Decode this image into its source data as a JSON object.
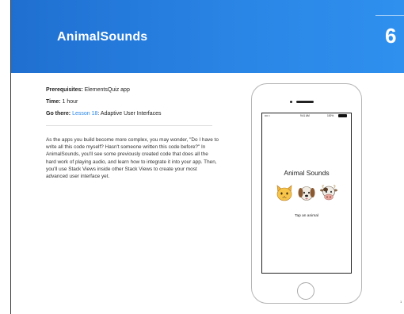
{
  "header": {
    "title": "AnimalSounds",
    "chapter_number": "6",
    "accent_color": "#2a86e6"
  },
  "meta": {
    "prerequisites_label": "Prerequisites:",
    "prerequisites_value": "ElementsQuiz app",
    "time_label": "Time:",
    "time_value": "1 hour",
    "go_there_label": "Go there:",
    "go_there_link": "Lesson 18",
    "go_there_rest": ": Adaptive User Interfaces"
  },
  "intro": {
    "text": "As the apps you build become more complex, you may wonder, \"Do I have to write all this code myself? Hasn't someone written this code before?\" In AnimalSounds, you'll see some previously created code that does all the hard work of playing audio, and learn how to integrate it into your app. Then, you'll use Stack Views inside other Stack Views to create your most advanced user interface yet."
  },
  "phone": {
    "status_carrier": "•••• ≈",
    "status_time": "9:41 AM",
    "status_battery": "100%",
    "app_title": "Animal Sounds",
    "animals": [
      {
        "name": "cat",
        "icon": "cat-face-icon"
      },
      {
        "name": "dog",
        "icon": "dog-face-icon"
      },
      {
        "name": "cow",
        "icon": "cow-face-icon"
      }
    ],
    "tap_label": "Tap an animal"
  },
  "corner_mark": "1"
}
